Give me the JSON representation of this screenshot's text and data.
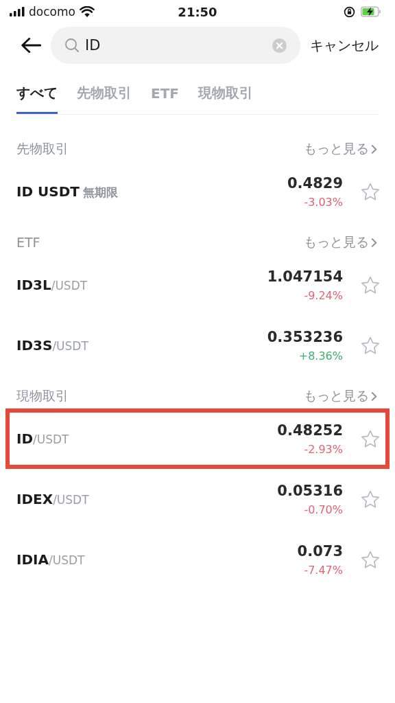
{
  "status_bar": {
    "carrier": "docomo",
    "time": "21:50"
  },
  "search": {
    "value": "ID",
    "cancel": "キャンセル"
  },
  "tabs": [
    {
      "label": "すべて",
      "selected": true
    },
    {
      "label": "先物取引",
      "selected": false
    },
    {
      "label": "ETF",
      "selected": false
    },
    {
      "label": "現物取引",
      "selected": false
    }
  ],
  "sections": [
    {
      "title": "先物取引",
      "more": "もっと見る",
      "rows": [
        {
          "kind": "futures",
          "base": "ID USDT",
          "tag": "無期限",
          "price": "0.4829",
          "change": "-3.03%",
          "color": "#e06471",
          "highlighted": false,
          "favorite": false
        }
      ]
    },
    {
      "title": "ETF",
      "more": "もっと見る",
      "rows": [
        {
          "kind": "pair",
          "base": "ID3L",
          "quote": "/USDT",
          "price": "1.047154",
          "change": "-9.24%",
          "color": "#e06471",
          "highlighted": false,
          "favorite": false
        },
        {
          "kind": "pair",
          "base": "ID3S",
          "quote": "/USDT",
          "price": "0.353236",
          "change": "+8.36%",
          "color": "#3fae6e",
          "highlighted": false,
          "favorite": false
        }
      ]
    },
    {
      "title": "現物取引",
      "more": "もっと見る",
      "rows": [
        {
          "kind": "pair",
          "base": "ID",
          "quote": "/USDT",
          "price": "0.48252",
          "change": "-2.93%",
          "color": "#e06471",
          "highlighted": true,
          "favorite": false
        },
        {
          "kind": "pair",
          "base": "IDEX",
          "quote": "/USDT",
          "price": "0.05316",
          "change": "-0.70%",
          "color": "#e06471",
          "highlighted": false,
          "favorite": false
        },
        {
          "kind": "pair",
          "base": "IDIA",
          "quote": "/USDT",
          "price": "0.073",
          "change": "-7.47%",
          "color": "#e06471",
          "highlighted": false,
          "favorite": false
        }
      ]
    }
  ]
}
